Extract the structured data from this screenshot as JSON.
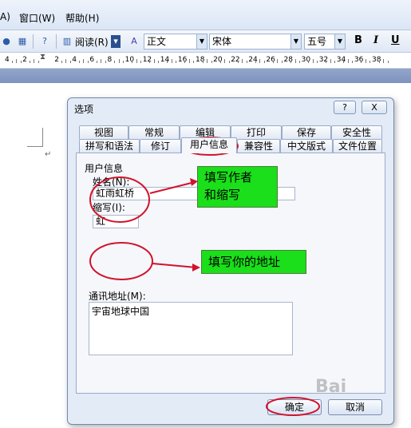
{
  "menubar": {
    "items": [
      "A)",
      "窗口(W)",
      "帮助(H)"
    ]
  },
  "toolbar": {
    "read_label": "阅读(R)",
    "style": "正文",
    "font": "宋体",
    "size": "五号",
    "bold": "B",
    "italic": "I",
    "underline": "U"
  },
  "ruler": {
    "labels": [
      "4",
      "2",
      "2",
      "4",
      "6",
      "8",
      "10",
      "12",
      "14",
      "16",
      "18",
      "20",
      "22",
      "24",
      "26",
      "28",
      "30",
      "32",
      "34",
      "36",
      "38"
    ]
  },
  "dialog": {
    "title": "选项",
    "help": "?",
    "close": "X",
    "tabs_row1": [
      "视图",
      "常规",
      "编辑",
      "打印",
      "保存",
      "安全性"
    ],
    "tabs_row2": [
      "拼写和语法",
      "修订",
      "用户信息",
      "兼容性",
      "中文版式",
      "文件位置"
    ],
    "section_title": "用户信息",
    "name_label": "姓名(N):",
    "name_value": "虹雨虹桥",
    "initials_label": "缩写(I):",
    "initials_value": "虹",
    "address_label": "通讯地址(M):",
    "address_value": "宇宙地球中国",
    "ok": "确定",
    "cancel": "取消"
  },
  "annotations": {
    "note1_line1": "填写作者",
    "note1_line2": "和缩写",
    "note2": "填写你的地址"
  },
  "colors": {
    "annotation_fill": "#1adf1a",
    "annotation_ink": "#d0142c"
  },
  "watermark": "Bai"
}
